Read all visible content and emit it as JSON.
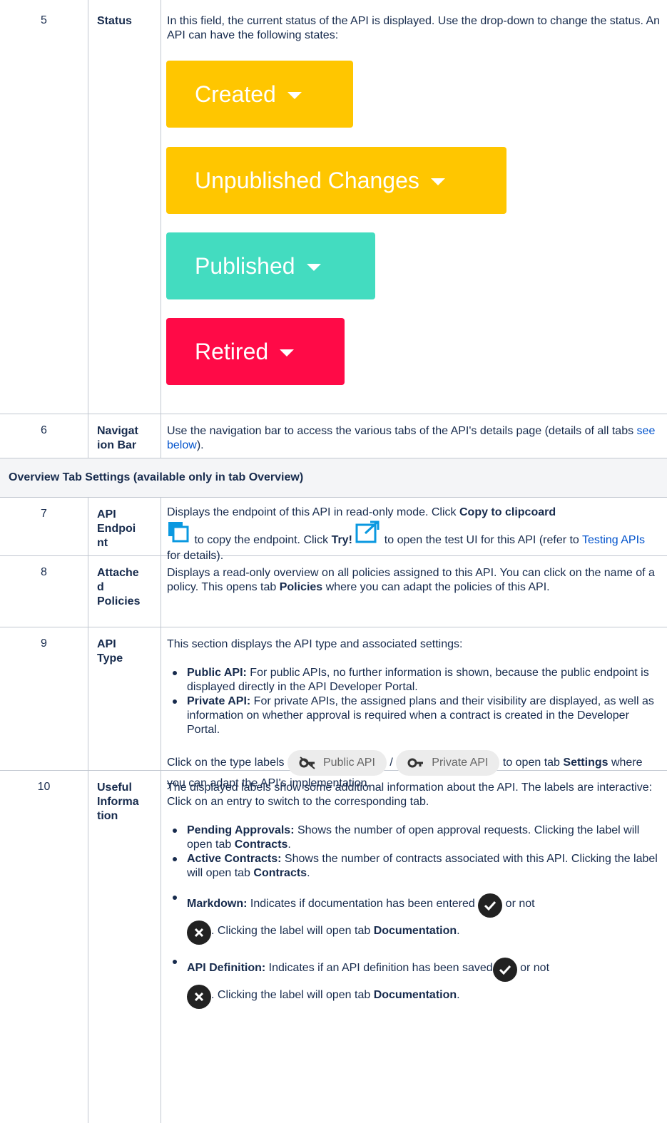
{
  "rows": {
    "r5": {
      "num": "5",
      "field": "Status",
      "desc": "In this field, the current status of the API is displayed. Use the drop-down to change the status. An API can have the following states:",
      "states": [
        {
          "label": "Created",
          "color": "#ffc600"
        },
        {
          "label": "Unpublished Changes",
          "color": "#ffc600"
        },
        {
          "label": "Published",
          "color": "#43dcc0"
        },
        {
          "label": "Retired",
          "color": "#ff0a47"
        }
      ]
    },
    "r6": {
      "num": "6",
      "field": "Navigation Bar",
      "desc_a": "Use the navigation bar to access the various tabs of the API's details page (details of all tabs ",
      "desc_link": "see below",
      "desc_b": ")."
    },
    "section": "Overview Tab Settings (available only in tab Overview)",
    "r7": {
      "num": "7",
      "field": "API Endpoint",
      "t1": "Displays the endpoint of this API in read-only mode. Click ",
      "b1": "Copy to clipcoard",
      "t2": " to copy the endpoint. Click ",
      "b2": "Try!",
      "t3": " to open the test UI for this API (refer to ",
      "link": "Testing APIs",
      "t4": " for details)."
    },
    "r8": {
      "num": "8",
      "field": "Attached Policies",
      "t1": "Displays a read-only overview on all policies assigned to this API. You can click on the name of a policy. This opens tab ",
      "b1": "Policies",
      "t2": " where you can adapt the policies of this API."
    },
    "r9": {
      "num": "9",
      "field": "API Type",
      "intro": "This section displays the API type and associated settings:",
      "bullets": [
        {
          "b": "Public API:",
          "t": " For public APIs, no further information is shown, because the public endpoint is displayed directly in the API Developer Portal."
        },
        {
          "b": "Private API:",
          "t": " For private APIs, the assigned plans and their visibility are displayed, as well as information on whether approval is required when a contract is created in the Developer Portal."
        }
      ],
      "click_pre": "Click on the type labels ",
      "public_pill": "Public API",
      "slash": " / ",
      "private_pill": "Private API",
      "click_post": " to open tab ",
      "click_bold": "Settings",
      "click_end": " where you can adapt the API's implementation."
    },
    "r10": {
      "num": "10",
      "field": "Useful Information",
      "intro": "The displayed labels show some additional information about the API. The labels are interactive: Click on an entry to switch to the corresponding tab.",
      "bullets": [
        {
          "b": "Pending Approvals:",
          "t": " Shows the number of open approval requests. Clicking the label will open tab ",
          "b2": "Contracts",
          "t2": "."
        },
        {
          "b": "Active Contracts:",
          "t": " Shows the number of contracts associated with this API. Clicking the label will open tab ",
          "b2": "Contracts",
          "t2": "."
        }
      ],
      "md_b": "Markdown:",
      "md_t": " Indicates if documentation has been entered ",
      "md_or": " or not",
      "md_t2": ". Clicking the label will open tab ",
      "md_b2": "Documentation",
      "md_end": ".",
      "def_b": "API Definition:",
      "def_t": " Indicates if an API definition has been saved",
      "def_or": " or not",
      "def_t2": ". Clicking the label will open tab ",
      "def_b2": "Documentation",
      "def_end": "."
    }
  }
}
